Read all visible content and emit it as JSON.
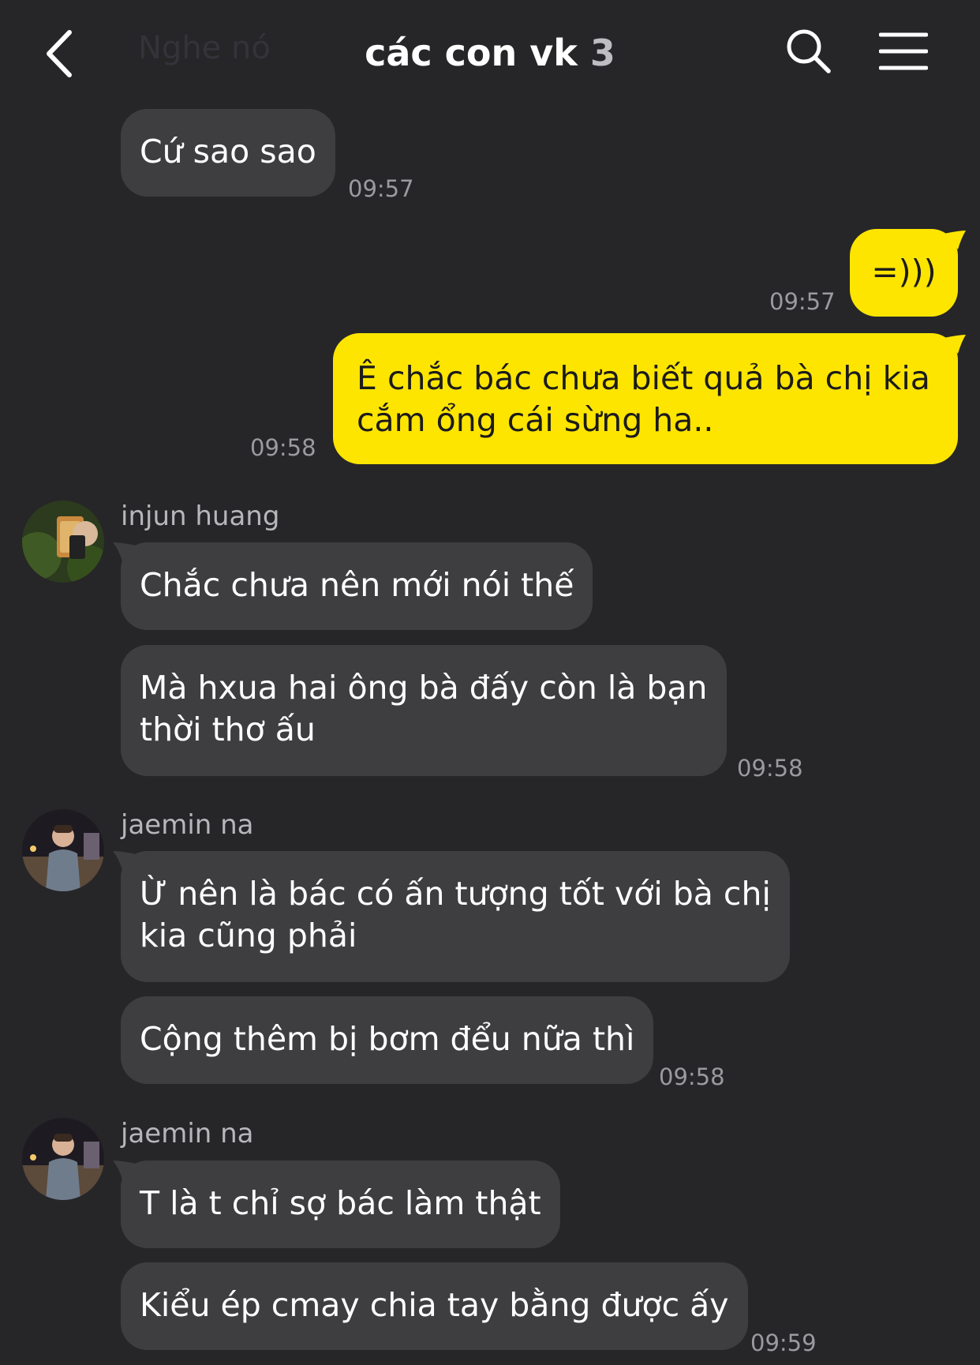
{
  "header": {
    "ghost_text": "Nghe nó",
    "title": "các con vk",
    "member_count": "3"
  },
  "messages": [
    {
      "text": "Cứ sao sao",
      "time": "09:57"
    },
    {
      "text": "=)))",
      "time": "09:57"
    },
    {
      "line1": "Ê chắc bác chưa biết quả bà chị kia",
      "line2": "cắm ổng cái sừng ha..",
      "time": "09:58"
    },
    {
      "sender": "injun huang"
    },
    {
      "text": "Chắc chưa nên mới nói thế"
    },
    {
      "line1": "Mà hxua hai ông bà đấy còn là bạn",
      "line2": "thời thơ ấu",
      "time": "09:58"
    },
    {
      "sender": "jaemin na"
    },
    {
      "line1": "Ừ nên là bác có ấn tượng tốt với bà chị",
      "line2": "kia cũng phải"
    },
    {
      "text": "Cộng thêm bị bơm đểu nữa thì",
      "time": "09:58"
    },
    {
      "sender": "jaemin na"
    },
    {
      "text": "T là t chỉ sợ bác làm thật"
    },
    {
      "text": "Kiểu ép cmay chia tay bằng được ấy",
      "time": "09:59"
    }
  ],
  "colors": {
    "background": "#262628",
    "incoming_bubble": "#3e3e41",
    "outgoing_bubble": "#fee500",
    "timestamp": "#9a9a9f"
  },
  "icons": [
    "chevron-left-icon",
    "search-icon",
    "hamburger-menu-icon"
  ]
}
